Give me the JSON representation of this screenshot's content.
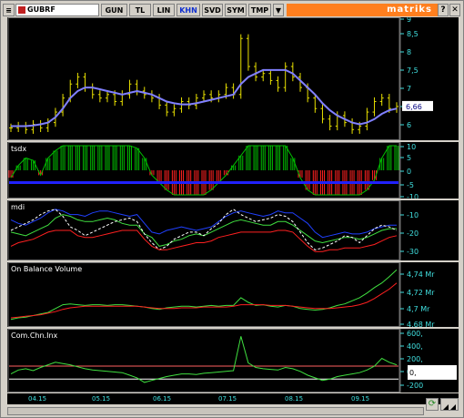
{
  "toolbar": {
    "symbol": "GUBRF",
    "buttons": [
      "GUN",
      "TL",
      "LIN",
      "KHN",
      "SVD",
      "SYM",
      "TMP"
    ],
    "active_button": "KHN",
    "dropdown_glyph": "▼",
    "brand": "matriks",
    "help_glyph": "?",
    "close_glyph": "✕"
  },
  "panels": {
    "price": {
      "axis_ticks": [
        "9",
        "8,5",
        "8",
        "7,5",
        "7",
        "6,5",
        "6"
      ],
      "last_value": "6,66"
    },
    "tsdx": {
      "title": "tsdx",
      "axis_ticks": [
        "10",
        "5",
        "0",
        "-5",
        "-10"
      ]
    },
    "mdi": {
      "title": "mdi",
      "axis_ticks": [
        "-10",
        "-20",
        "-30"
      ]
    },
    "obv": {
      "title": "On Balance Volume",
      "axis_ticks": [
        "4,74 Mr",
        "4,72 Mr",
        "4,7 Mr",
        "4,68 Mr"
      ]
    },
    "cci": {
      "title": "Com.Chn.Inx",
      "axis_ticks": [
        "600,",
        "400,",
        "200,",
        "0,",
        "-200"
      ],
      "value_box": "0,"
    }
  },
  "dates": [
    "04.15",
    "05.15",
    "06.15",
    "07.15",
    "08.15",
    "09.15"
  ],
  "colors": {
    "background": "#000000",
    "price_bars": "#e8e000",
    "moving_average": "#8080ff",
    "positive_hist": "#00c000",
    "negative_hist": "#ff2020",
    "zero_line_blue": "#2020ff",
    "axis_text": "#40e0e0",
    "title_text": "#ffffff",
    "brand_bar": "#ff7f1f"
  },
  "chart_data": [
    {
      "type": "line",
      "title": "",
      "series": [
        {
          "values": [
            6.05,
            6.1,
            6.0,
            6.15,
            6.05,
            6.2,
            6.5,
            6.9,
            7.3,
            7.5,
            7.2,
            7.0,
            6.9,
            7.0,
            6.8,
            7.0,
            7.3,
            7.1,
            7.0,
            6.9,
            6.7,
            6.5,
            6.6,
            6.8,
            6.7,
            6.9,
            7.0,
            6.9,
            7.0,
            7.2,
            7.0,
            8.6,
            7.8,
            7.5,
            7.6,
            7.4,
            7.2,
            7.8,
            7.5,
            7.2,
            6.9,
            6.6,
            6.3,
            6.1,
            6.4,
            6.2,
            6.0,
            6.1,
            6.5,
            6.8,
            6.9,
            6.6,
            6.66
          ]
        },
        {
          "values": [
            6.1,
            6.1,
            6.1,
            6.12,
            6.15,
            6.2,
            6.35,
            6.6,
            6.9,
            7.1,
            7.2,
            7.2,
            7.15,
            7.1,
            7.05,
            7.0,
            7.05,
            7.1,
            7.05,
            7.0,
            6.9,
            6.8,
            6.75,
            6.72,
            6.72,
            6.75,
            6.8,
            6.85,
            6.9,
            6.95,
            7.0,
            7.3,
            7.5,
            7.6,
            7.7,
            7.7,
            7.7,
            7.7,
            7.6,
            7.4,
            7.2,
            7.0,
            6.75,
            6.55,
            6.4,
            6.3,
            6.2,
            6.15,
            6.2,
            6.3,
            6.45,
            6.55,
            6.6
          ]
        }
      ],
      "categories": [
        "04.15",
        "05.15",
        "06.15",
        "07.15",
        "08.15",
        "09.15"
      ],
      "ylim": [
        5.8,
        9.1
      ]
    },
    {
      "type": "bar",
      "title": "tsdx",
      "values": [
        -3,
        2,
        5,
        4,
        -2,
        5,
        8,
        10,
        10,
        10,
        10,
        10,
        10,
        10,
        10,
        10,
        10,
        9,
        5,
        -2,
        -5,
        -8,
        -10,
        -10,
        -10,
        -10,
        -10,
        -8,
        -5,
        -2,
        2,
        6,
        10,
        10,
        10,
        10,
        10,
        10,
        5,
        -3,
        -8,
        -10,
        -10,
        -10,
        -10,
        -10,
        -10,
        -10,
        -8,
        -4,
        5,
        10,
        10
      ],
      "ylim": [
        -10,
        10
      ]
    },
    {
      "type": "line",
      "title": "mdi",
      "series": [
        {
          "values": [
            -15,
            -17,
            -18,
            -16,
            -14,
            -11,
            -9,
            -10,
            -12,
            -12,
            -13,
            -11,
            -10,
            -10,
            -11,
            -12,
            -13,
            -12,
            -17,
            -22,
            -23,
            -21,
            -20,
            -19,
            -20,
            -21,
            -20,
            -19,
            -16,
            -13,
            -11,
            -10,
            -11,
            -12,
            -13,
            -12,
            -10,
            -11,
            -11,
            -14,
            -17,
            -22,
            -25,
            -24,
            -23,
            -22,
            -23,
            -23,
            -22,
            -20,
            -19,
            -18,
            -18
          ]
        },
        {
          "values": [
            -22,
            -23,
            -24,
            -22,
            -20,
            -18,
            -14,
            -12,
            -13,
            -15,
            -16,
            -16,
            -15,
            -14,
            -15,
            -17,
            -18,
            -18,
            -23,
            -25,
            -30,
            -29,
            -27,
            -26,
            -24,
            -23,
            -24,
            -22,
            -20,
            -18,
            -16,
            -15,
            -16,
            -17,
            -18,
            -18,
            -16,
            -16,
            -18,
            -21,
            -24,
            -27,
            -28,
            -27,
            -26,
            -25,
            -25,
            -26,
            -25,
            -23,
            -21,
            -20,
            -20
          ]
        },
        {
          "values": [
            -21,
            -19,
            -17,
            -15,
            -12,
            -10,
            -9,
            -13,
            -19,
            -21,
            -24,
            -22,
            -20,
            -18,
            -16,
            -15,
            -14,
            -16,
            -23,
            -28,
            -32,
            -30,
            -26,
            -24,
            -22,
            -22,
            -24,
            -20,
            -17,
            -12,
            -9,
            -12,
            -14,
            -16,
            -15,
            -14,
            -12,
            -13,
            -16,
            -22,
            -28,
            -32,
            -31,
            -29,
            -27,
            -24,
            -25,
            -28,
            -24,
            -20,
            -18,
            -19,
            -21
          ]
        },
        {
          "values": [
            -30,
            -28,
            -27,
            -26,
            -24,
            -22,
            -21,
            -21,
            -21,
            -24,
            -25,
            -25,
            -24,
            -23,
            -22,
            -21,
            -21,
            -21,
            -26,
            -30,
            -32,
            -32,
            -31,
            -30,
            -29,
            -28,
            -28,
            -27,
            -25,
            -24,
            -23,
            -22,
            -22,
            -22,
            -22,
            -22,
            -21,
            -21,
            -22,
            -26,
            -30,
            -33,
            -33,
            -32,
            -32,
            -31,
            -31,
            -31,
            -30,
            -29,
            -27,
            -25,
            -24
          ]
        }
      ],
      "ylim": [
        -36,
        -6
      ]
    },
    {
      "type": "line",
      "title": "On Balance Volume",
      "series": [
        {
          "values": [
            4.681,
            4.683,
            4.684,
            4.686,
            4.688,
            4.69,
            4.695,
            4.7,
            4.701,
            4.7,
            4.699,
            4.7,
            4.7,
            4.699,
            4.7,
            4.7,
            4.699,
            4.698,
            4.697,
            4.695,
            4.694,
            4.696,
            4.697,
            4.698,
            4.698,
            4.697,
            4.698,
            4.699,
            4.698,
            4.699,
            4.699,
            4.709,
            4.703,
            4.699,
            4.7,
            4.698,
            4.697,
            4.699,
            4.698,
            4.695,
            4.694,
            4.693,
            4.694,
            4.696,
            4.699,
            4.701,
            4.705,
            4.709,
            4.715,
            4.722,
            4.728,
            4.736,
            4.745
          ]
        },
        {
          "values": [
            4.683,
            4.684,
            4.685,
            4.686,
            4.687,
            4.689,
            4.691,
            4.694,
            4.696,
            4.697,
            4.698,
            4.698,
            4.698,
            4.698,
            4.698,
            4.698,
            4.698,
            4.698,
            4.697,
            4.696,
            4.695,
            4.695,
            4.695,
            4.696,
            4.696,
            4.696,
            4.697,
            4.697,
            4.697,
            4.697,
            4.698,
            4.7,
            4.7,
            4.7,
            4.7,
            4.699,
            4.699,
            4.699,
            4.698,
            4.697,
            4.696,
            4.695,
            4.695,
            4.695,
            4.696,
            4.697,
            4.698,
            4.7,
            4.703,
            4.708,
            4.714,
            4.72,
            4.728
          ]
        }
      ],
      "ylim": [
        4.676,
        4.75
      ]
    },
    {
      "type": "line",
      "title": "Com.Chn.Inx",
      "series": [
        {
          "values": [
            -20,
            40,
            60,
            30,
            80,
            120,
            160,
            140,
            120,
            90,
            60,
            40,
            30,
            20,
            10,
            0,
            -40,
            -80,
            -150,
            -120,
            -90,
            -60,
            -40,
            -20,
            -20,
            -30,
            -10,
            0,
            10,
            20,
            30,
            560,
            150,
            80,
            60,
            50,
            40,
            80,
            60,
            20,
            -40,
            -80,
            -120,
            -100,
            -60,
            -40,
            -20,
            0,
            40,
            100,
            220,
            160,
            120
          ]
        }
      ],
      "ylim": [
        -250,
        620
      ]
    }
  ]
}
